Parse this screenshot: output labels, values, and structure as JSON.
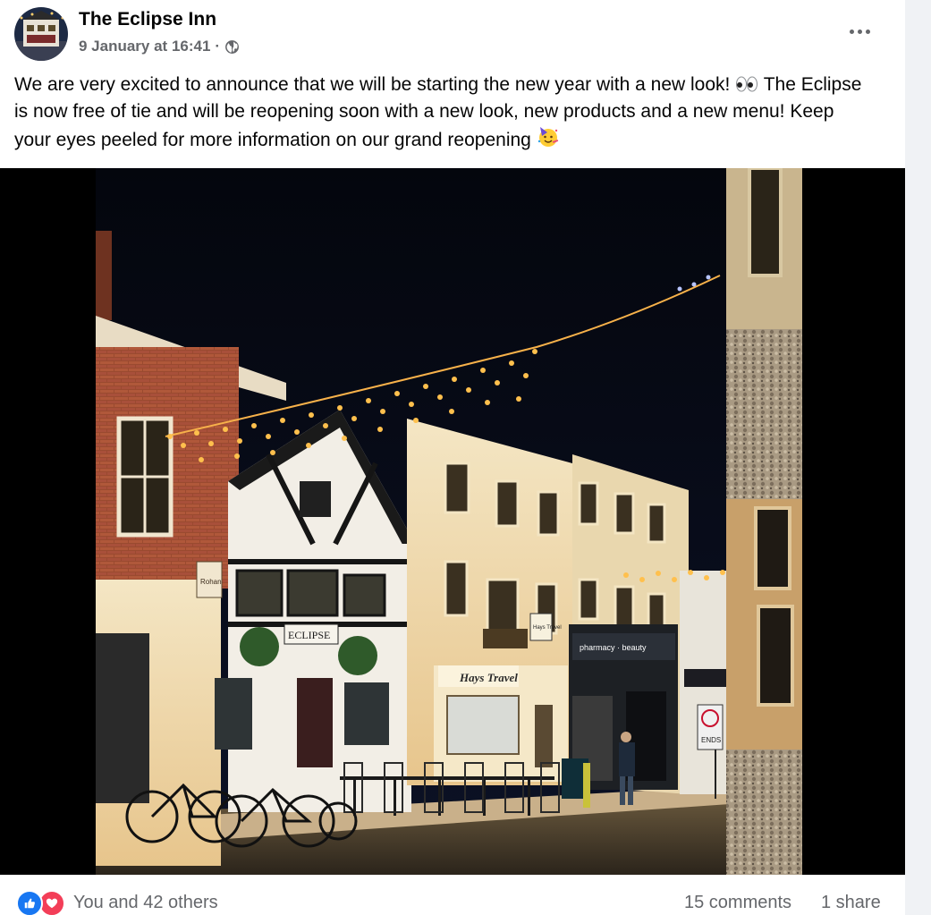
{
  "post": {
    "page_name": "The Eclipse Inn",
    "timestamp": "9 January at 16:41",
    "separator": "·",
    "audience_icon": "globe-icon",
    "more_icon": "more-options-icon",
    "text_part1": "We are very excited to announce that we will be starting the new year with a new look!",
    "emoji1": "eyes-emoji",
    "text_part2": "The Eclipse is now free of tie and will be reopening soon with a new look, new products and a new menu! Keep your eyes peeled for more information on our grand reopening",
    "emoji2": "partying-face-emoji"
  },
  "photo": {
    "signs": {
      "eclipse": "ECLIPSE",
      "hays": "Hays Travel",
      "hays_small": "Hays Travel",
      "rohan": "Rohan",
      "pharmacy": "pharmacy · beauty",
      "parking": "ENDS"
    }
  },
  "footer": {
    "reactions": [
      "like-icon",
      "love-icon"
    ],
    "reactions_text": "You and 42 others",
    "comments": "15 comments",
    "shares": "1 share"
  },
  "colors": {
    "facebook_blue": "#1877f2",
    "love_red": "#f33e58",
    "secondary_text": "#65676b"
  }
}
